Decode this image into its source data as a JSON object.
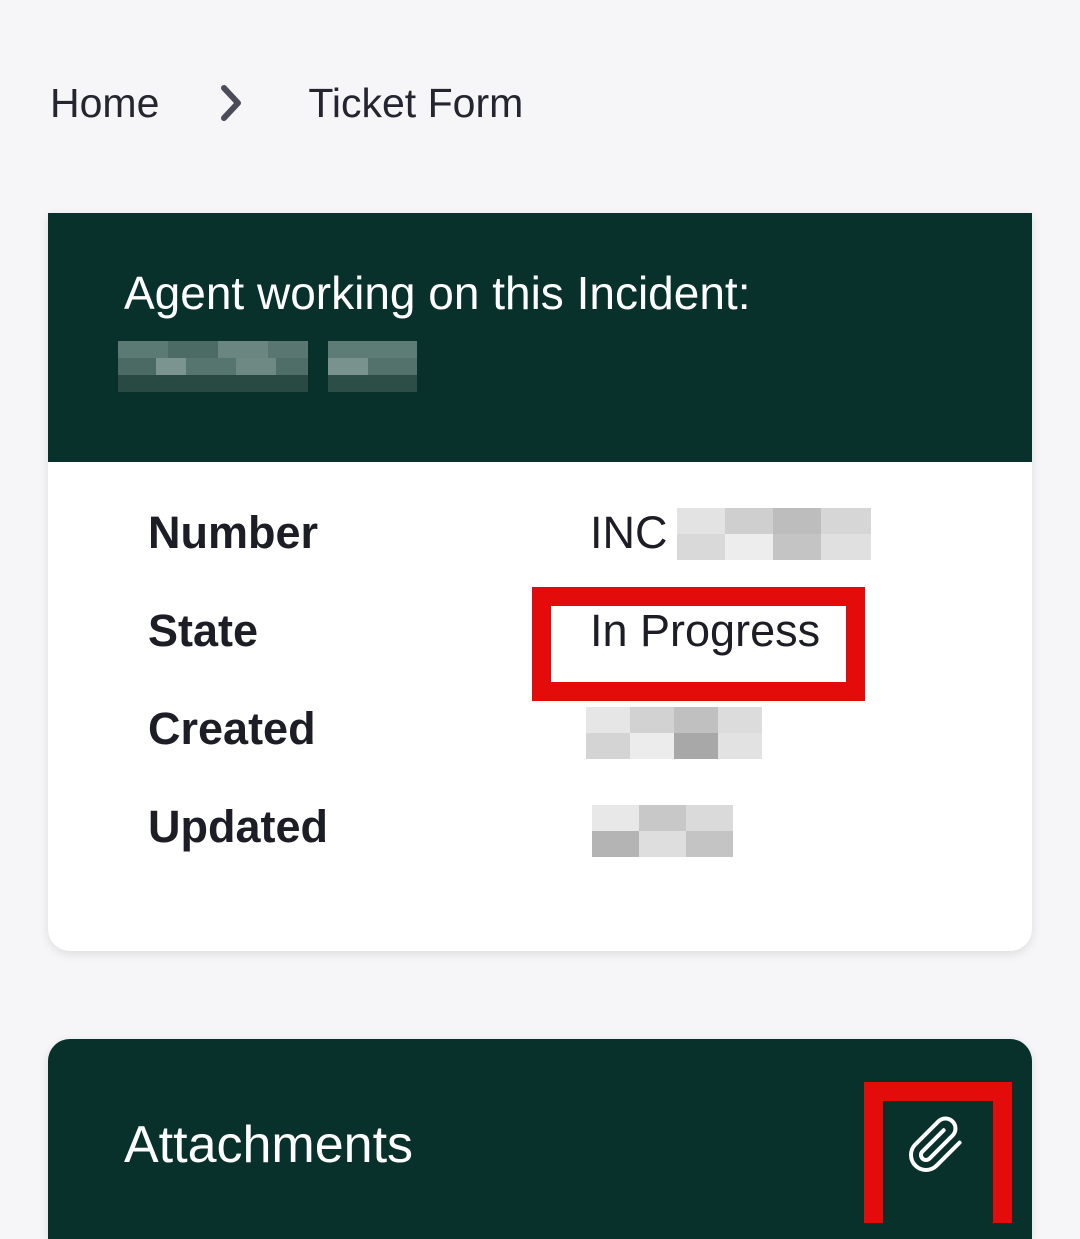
{
  "breadcrumb": {
    "home_label": "Home",
    "separator_icon": "chevron-right-icon",
    "current_label": "Ticket Form"
  },
  "agent_card": {
    "title": "Agent working on this Incident:",
    "agent_name_state": "redacted (pixelated)"
  },
  "details": {
    "number": {
      "label": "Number",
      "value_prefix": "INC"
    },
    "state": {
      "label": "State",
      "value": "In Progress"
    },
    "created": {
      "label": "Created"
    },
    "updated": {
      "label": "Updated"
    }
  },
  "attachments": {
    "title": "Attachments",
    "icon": "paperclip-icon"
  },
  "colors": {
    "header_bg": "#09312b",
    "page_bg": "#f6f6f8",
    "highlight": "#e40b0b",
    "text": "#1d1d26"
  }
}
